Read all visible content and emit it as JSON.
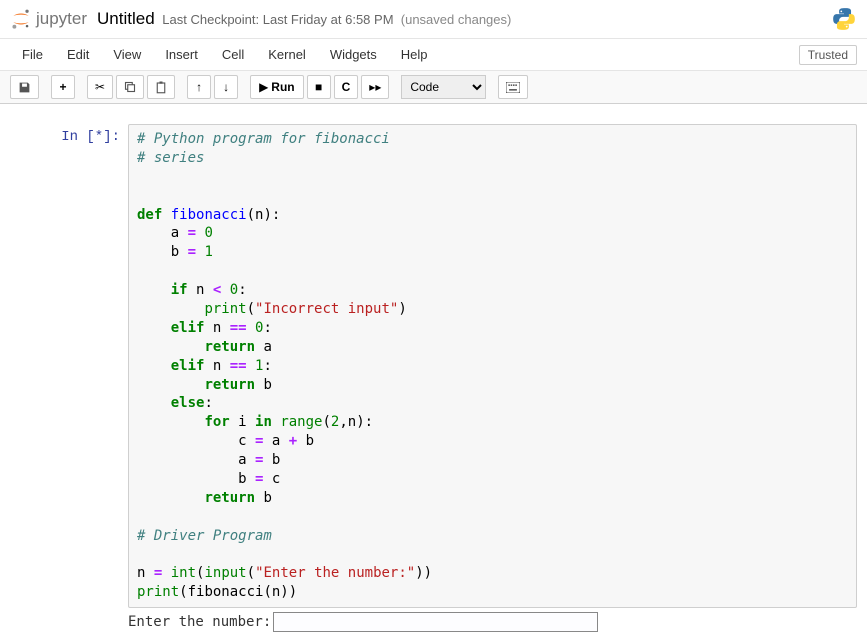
{
  "header": {
    "brand": "jupyter",
    "title": "Untitled",
    "checkpoint": "Last Checkpoint: Last Friday at 6:58 PM",
    "unsaved": "(unsaved changes)"
  },
  "menu": {
    "file": "File",
    "edit": "Edit",
    "view": "View",
    "insert": "Insert",
    "cell": "Cell",
    "kernel": "Kernel",
    "widgets": "Widgets",
    "help": "Help",
    "trusted": "Trusted"
  },
  "toolbar": {
    "run": "Run",
    "celltype": "Code"
  },
  "cell": {
    "prompt": "In [*]:",
    "code_lines": [
      {
        "t": "comment",
        "v": "# Python program for fibonacci"
      },
      {
        "t": "comment",
        "v": "# series"
      },
      {
        "t": "blank",
        "v": ""
      },
      {
        "t": "blank",
        "v": ""
      },
      {
        "t": "def",
        "kw": "def",
        "name": "fibonacci",
        "rest": "(n):"
      },
      {
        "t": "assign",
        "indent": "    ",
        "lhs": "a",
        "op": "=",
        "rhs_num": "0"
      },
      {
        "t": "assign",
        "indent": "    ",
        "lhs": "b",
        "op": "=",
        "rhs_num": "1"
      },
      {
        "t": "blank",
        "v": ""
      },
      {
        "t": "if",
        "indent": "    ",
        "kw": "if",
        "rest1": " n ",
        "op": "<",
        "rest2": " ",
        "num": "0",
        "colon": ":"
      },
      {
        "t": "print",
        "indent": "        ",
        "fn": "print",
        "open": "(",
        "str": "\"Incorrect input\"",
        "close": ")"
      },
      {
        "t": "elif",
        "indent": "    ",
        "kw": "elif",
        "rest1": " n ",
        "op": "==",
        "rest2": " ",
        "num": "0",
        "colon": ":"
      },
      {
        "t": "return",
        "indent": "        ",
        "kw": "return",
        "rest": " a"
      },
      {
        "t": "elif",
        "indent": "    ",
        "kw": "elif",
        "rest1": " n ",
        "op": "==",
        "rest2": " ",
        "num": "1",
        "colon": ":"
      },
      {
        "t": "return",
        "indent": "        ",
        "kw": "return",
        "rest": " b"
      },
      {
        "t": "else",
        "indent": "    ",
        "kw": "else",
        "colon": ":"
      },
      {
        "t": "for",
        "indent": "        ",
        "kw1": "for",
        "mid": " i ",
        "kw2": "in",
        "fn": " range",
        "open": "(",
        "num1": "2",
        "comma": ",n",
        "close": "):"
      },
      {
        "t": "assign2",
        "indent": "            ",
        "lhs": "c",
        "op": "=",
        "rhs": " a ",
        "op2": "+",
        "rhs2": " b"
      },
      {
        "t": "assign3",
        "indent": "            ",
        "lhs": "a",
        "op": "=",
        "rhs": " b"
      },
      {
        "t": "assign3",
        "indent": "            ",
        "lhs": "b",
        "op": "=",
        "rhs": " c"
      },
      {
        "t": "return",
        "indent": "        ",
        "kw": "return",
        "rest": " b"
      },
      {
        "t": "blank",
        "v": ""
      },
      {
        "t": "comment",
        "v": "# Driver Program"
      },
      {
        "t": "blank",
        "v": ""
      },
      {
        "t": "input",
        "lhs": "n ",
        "op": "=",
        "sp": " ",
        "fn1": "int",
        "open1": "(",
        "fn2": "input",
        "open2": "(",
        "str": "\"Enter the number:\"",
        "close": "))"
      },
      {
        "t": "printcall",
        "fn": "print",
        "open": "(",
        "call": "fibonacci(n)",
        "close": ")"
      }
    ]
  },
  "output": {
    "prompt_text": "Enter the number:",
    "input_value": ""
  }
}
